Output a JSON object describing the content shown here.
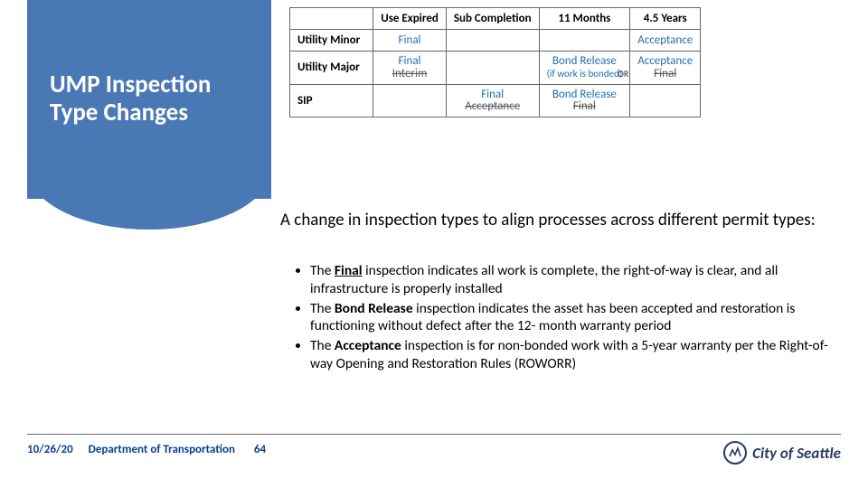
{
  "title": "UMP Inspection Type Changes",
  "table": {
    "headers": [
      "",
      "Use Expired",
      "Sub Completion",
      "11 Months",
      "4.5 Years"
    ],
    "rows": [
      {
        "label": "Utility Minor",
        "use_expired": "Final",
        "sub_completion": "",
        "eleven": "",
        "fourfive": "Acceptance"
      },
      {
        "label": "Utility Major",
        "use_expired_new": "Final",
        "use_expired_old": "Interim",
        "sub_completion": "",
        "eleven_new": "Bond Release",
        "eleven_note": "(if work is bonded)",
        "or": "OR",
        "fourfive_new": "Acceptance",
        "fourfive_old": "Final"
      },
      {
        "label": "SIP",
        "use_expired": "",
        "sub_new": "Final",
        "sub_old": "Acceptance",
        "eleven_new": "Bond Release",
        "eleven_old": "Final",
        "fourfive": ""
      }
    ]
  },
  "intro": "A change in inspection types to align processes across different permit types:",
  "bullets": [
    {
      "bold": "Final",
      "prefix": "The ",
      "rest": " inspection indicates all work is complete, the right-of-way is clear, and all infrastructure is properly installed"
    },
    {
      "bold": "Bond Release",
      "prefix": "The ",
      "rest": " inspection indicates the asset has been accepted and restoration is functioning without defect after the 12- month warranty period"
    },
    {
      "bold": "Acceptance",
      "prefix": "The ",
      "rest": " inspection is for non-bonded work with a 5-year warranty per the Right-of-way Opening and Restoration Rules (ROWORR)"
    }
  ],
  "footer": {
    "date": "10/26/20",
    "dept": "Department of Transportation",
    "page": "64"
  },
  "logo_text": "City of Seattle"
}
